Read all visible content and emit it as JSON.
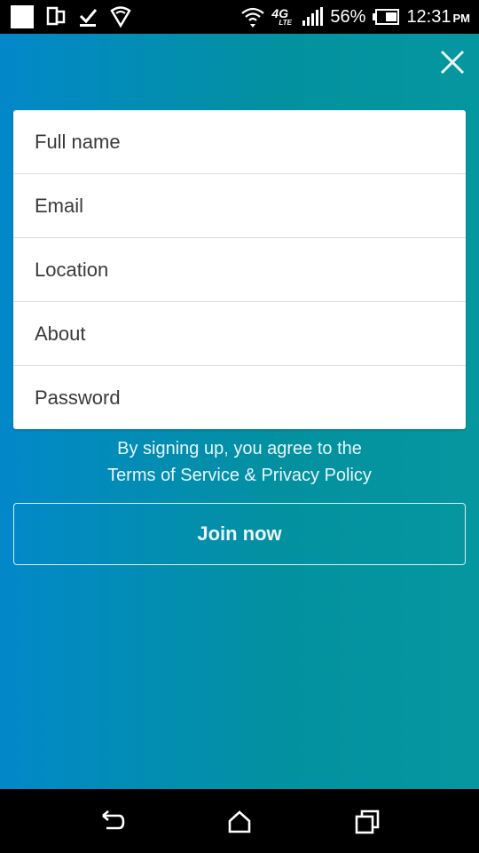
{
  "status_bar": {
    "battery_percent": "56%",
    "time": "12:31",
    "ampm": "PM",
    "network_label": "4G",
    "network_sub": "LTE",
    "icons": [
      "notification-square-icon",
      "phone-rotate-icon",
      "checkmark-download-icon",
      "shield-icon",
      "wifi-icon",
      "signal-icon",
      "battery-icon"
    ]
  },
  "form": {
    "full_name_placeholder": "Full name",
    "email_placeholder": "Email",
    "location_placeholder": "Location",
    "about_placeholder": "About",
    "password_placeholder": "Password"
  },
  "terms": {
    "line1": "By signing up, you agree to the",
    "line2": "Terms of Service & Privacy Policy"
  },
  "join_button": "Join now",
  "colors": {
    "gradient_left": "#0288c9",
    "gradient_right": "#0597a0",
    "card": "#ffffff"
  },
  "nav_icons": [
    "back-icon",
    "home-icon",
    "recent-apps-icon"
  ]
}
